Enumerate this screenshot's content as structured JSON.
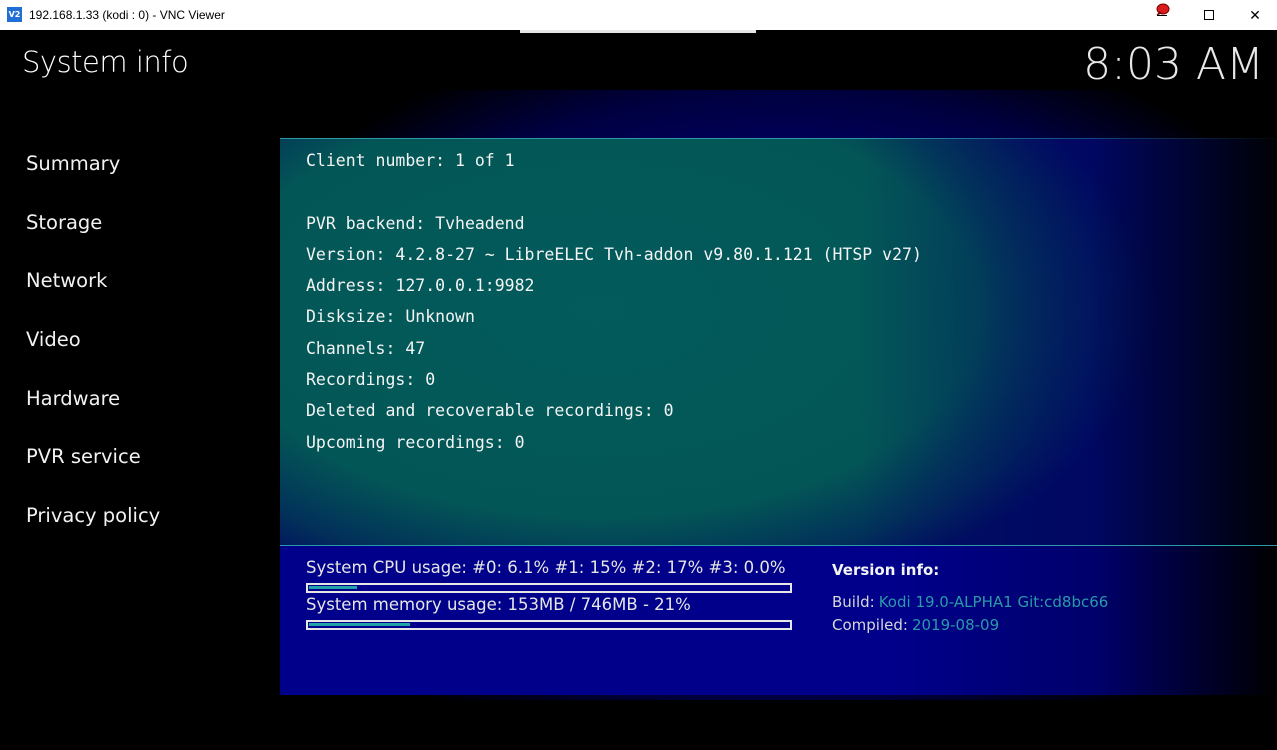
{
  "window": {
    "app_icon_text": "V2",
    "title": "192.168.1.33 (kodi : 0) - VNC Viewer",
    "icons": [
      "vnc-viewer-icon",
      "chat-bubble-icon",
      "minimize-icon",
      "maximize-icon",
      "close-icon"
    ],
    "close_glyph": "✕"
  },
  "header": {
    "title": "System info",
    "clock": "8:03 AM"
  },
  "sidebar": {
    "items": [
      {
        "label": "Summary"
      },
      {
        "label": "Storage"
      },
      {
        "label": "Network"
      },
      {
        "label": "Video"
      },
      {
        "label": "Hardware"
      },
      {
        "label": "PVR service"
      },
      {
        "label": "Privacy policy"
      }
    ]
  },
  "info": {
    "client_number": "Client number: 1 of 1",
    "pvr_backend": "PVR backend: Tvheadend",
    "version": "Version: 4.2.8-27 ~ LibreELEC Tvh-addon v9.80.1.121 (HTSP v27)",
    "address": "Address: 127.0.0.1:9982",
    "disksize": "Disksize: Unknown",
    "channels": "Channels: 47",
    "recordings": "Recordings: 0",
    "deleted_recordings": "Deleted and recoverable recordings: 0",
    "upcoming_recordings": "Upcoming recordings: 0"
  },
  "usage": {
    "cpu_label": "System CPU usage: #0: 6.1% #1:  15% #2:  17% #3: 0.0%",
    "cpu_fraction": 0.1,
    "memory_label": "System memory usage: 153MB / 746MB - 21%",
    "memory_fraction": 0.21
  },
  "version_info": {
    "heading": "Version info:",
    "build_key": "Build:",
    "build_value": "Kodi 19.0-ALPHA1 Git:cd8bc66",
    "compiled_key": "Compiled:",
    "compiled_value": "2019-08-09"
  },
  "colors": {
    "accent": "#2a9aa8",
    "panel": "#035858",
    "background_glow": "#00008a"
  }
}
